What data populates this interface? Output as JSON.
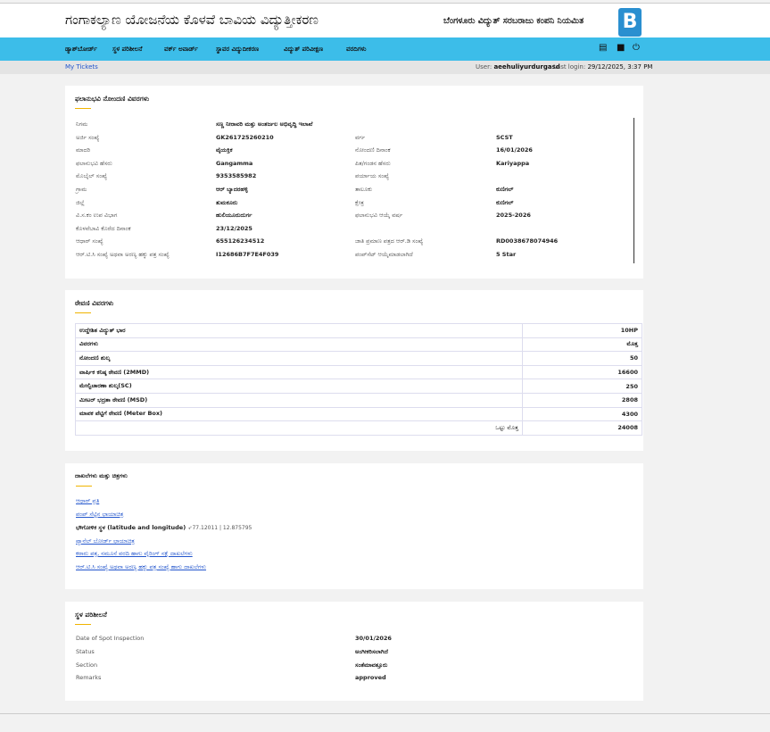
{
  "header": {
    "title": "ಗಂಗಾಕಲ್ಯಾಣ ಯೋಜನೆಯ ಕೊಳವೆ ಬಾವಿಯ ವಿದ್ಯುತ್ತೀಕರಣ",
    "org": "ಬೆಂಗಳೂರು ವಿದ್ಯುತ್ ಸರಬರಾಜು ಕಂಪನಿ ನಿಯಮಿತ",
    "logo_text": "B"
  },
  "nav": {
    "items": [
      "ಡ್ಯಾಶ್‌ಬೋರ್ಡ್",
      "ಸ್ಥಳ ಪರಿಶೀಲನೆ",
      "ವರ್ಕ್ ಅವಾರ್ಡ್",
      "ಸ್ಥಾವರ ವಿದ್ಯುದೀಕರಣ",
      "ವಿದ್ಯುತ್ ಪರಿವೀಕ್ಷಣ",
      "ವರದಿಗಳು"
    ],
    "icons": [
      "book-icon",
      "lock-icon",
      "power-icon"
    ]
  },
  "subbar": {
    "link": "My Tickets",
    "user_label": "User:",
    "user": "aeehuliyurdurgasd",
    "last_login_label": "Last login:",
    "last_login": "29/12/2025, 3:37 PM"
  },
  "registration": {
    "title": "ಫಲಾನುಭವಿ ನೋಂದಣಿ ವಿವರಗಳು",
    "left": [
      [
        "ನಿಗಮ",
        "ಸಣ್ಣ ನೀರಾವರಿ ಮತ್ತು ಅಂತರ್ಜಲ ಅಭಿವೃದ್ಧಿ ಇಲಾಖೆ"
      ],
      [
        "ಅರ್ಜಿ ಸಂಖ್ಯೆ",
        "GK261725260210"
      ],
      [
        "ಮಾದರಿ",
        "ವೈಯಕ್ತಿಕ"
      ],
      [
        "ಫಲಾನುಭವಿ ಹೆಸರು",
        "Gangamma"
      ],
      [
        "ಮೊಬೈಲ್ ಸಂಖ್ಯೆ",
        "9353585982"
      ],
      [
        "ಗ್ರಾಮ",
        "ಆರ್ ಬ್ಯಾದರಹಳ್ಳಿ"
      ],
      [
        "ಜಿಲ್ಲೆ",
        "ತುಮಕೂರು"
      ],
      [
        "ವಿ.ಸ.ಕಂ ಉಪ ವಿಭಾಗ",
        "ಹುಲಿಯೂರುದುರ್ಗ"
      ],
      [
        "ಕೊಳವೆಬಾವಿ ಕೊರೆದ ದಿನಾಂಕ",
        "23/12/2025"
      ],
      [
        "ಆಧಾರ್ ಸಂಖ್ಯೆ",
        "655126234512"
      ],
      [
        "ಆರ್.ಟಿ.ಸಿ ಸಂಖ್ಯೆ ಅಥವಾ ಅರಣ್ಯ ಹಕ್ಕು ಪತ್ರ ಸಂಖ್ಯೆ",
        "I12686B7F7E4F039"
      ]
    ],
    "right": [
      [
        "",
        ""
      ],
      [
        "ವರ್ಗ",
        "SCST"
      ],
      [
        "ನೋಂದಣಿ ದಿನಾಂಕ",
        "16/01/2026"
      ],
      [
        "ಪಿತ/ಗಂಡನ ಹೆಸರು",
        "Kariyappa"
      ],
      [
        "ಪರ್ಯಾಯ ಸಂಖ್ಯೆ",
        ""
      ],
      [
        "ತಾಲೂಕು",
        "ಕುಣಿಗಲ್"
      ],
      [
        "ಕ್ಷೇತ್ರ",
        "ಕುಣಿಗಲ್"
      ],
      [
        "ಫಲಾನುಭವಿ ಆಯ್ಕೆ ವರ್ಷ",
        "2025-2026"
      ],
      [
        "",
        ""
      ],
      [
        "ಜಾತಿ ಪ್ರಮಾಣ ಪತ್ರದ ಆರ್.ಡಿ ಸಂಖ್ಯೆ",
        "RD0038678074946"
      ],
      [
        "ಪಂಪ್‌ಸೆಟ್ ಆಯ್ಕೆಮಾಡಲಾಗಿದೆ",
        "5 Star"
      ]
    ]
  },
  "deposit": {
    "title": "ಠೇವಣಿ ವಿವರಗಳು",
    "rows": [
      [
        "ಉದ್ದೇಶಿತ ವಿದ್ಯುತ್ ಭಾರ",
        "10HP"
      ],
      [
        "ವಿವರಗಳು",
        "ಮೊತ್ತ"
      ],
      [
        "ನೋಂದಣಿ ಶುಲ್ಕ",
        "50"
      ],
      [
        "ವಾರ್ಷಿಕ ಕನಿಷ್ಠ ಠೇವಣಿ (2MMD)",
        "16600"
      ],
      [
        "ಮೇಲ್ವಿಚಾರಣಾ ಶುಲ್ಕ(SC)",
        "250"
      ],
      [
        "ಮೀಟರ್ ಭದ್ರತಾ ಠೇವಣಿ (MSD)",
        "2808"
      ],
      [
        "ಮಾಪಕ ಪೆಟ್ಟಿಗೆ ಠೇವಣಿ (Meter Box)",
        "4300"
      ]
    ],
    "total_label": "ಒಟ್ಟು ಮೊತ್ತ",
    "total": "24008"
  },
  "documents": {
    "title": "ದಾಖಲೆಗಳು ಮತ್ತು ಚಿತ್ರಗಳು",
    "link1": "ಆಧಾರ್ ಪ್ರತಿ",
    "link2": "ಪಂಪ್ ಸೆಟ್ಟಿನ ಛಾಯಾಚಿತ್ರ",
    "geo_label": "ಭೌಗೋಳಿಕ ಸ್ಥಳ (latitude and longitude)",
    "geo_value": "➶77.12011 | 12.875795",
    "link3": "ಪ್ಯಾನೆಲ್ ಬೋರ್ಡ್ ಛಾಯಾಚಿತ್ರ",
    "link4": "ಕರಾರು ಪತ್ರ, ನಮೂನೆ ವರದಿ ಹಾಗು ವೈರಿಂಗ್ ನಕ್ಷೆ ದಾಖಲೆಗಳು",
    "link5": "ಆರ್.ಟಿ.ಸಿ ಸಂಖ್ಯೆ ಅಥವಾ ಅರಣ್ಯ ಹಕ್ಕು ಪತ್ರ ಸಂಖ್ಯೆ ಹಾಗು ದಾಖಲೆಗಳು"
  },
  "inspection": {
    "title": "ಸ್ಥಳ ಪರಿಶೀಲನೆ",
    "rows": [
      [
        "Date of Spot Inspection",
        "30/01/2026"
      ],
      [
        "Status",
        "ಅಂಗೀಕರಿಸಲಾಗಿದೆ"
      ],
      [
        "Section",
        "ಸಂತೆಮಾವತ್ತೂರು"
      ],
      [
        "Remarks",
        "approved"
      ]
    ]
  }
}
